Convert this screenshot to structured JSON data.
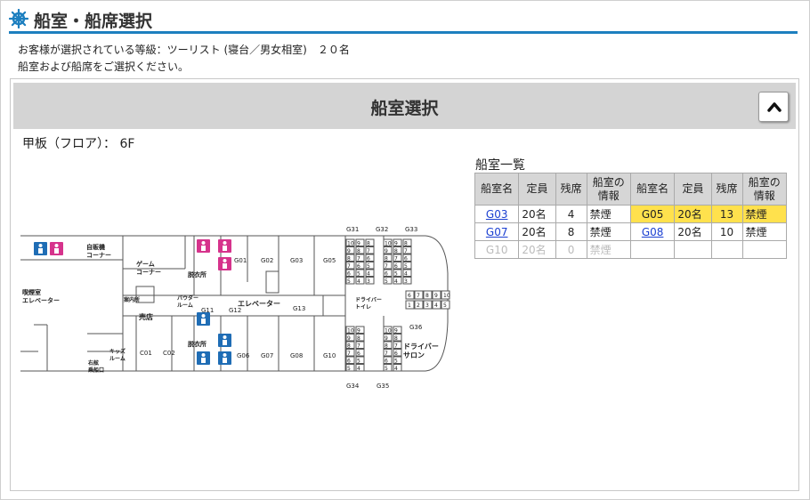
{
  "header": {
    "title": "船室・船席選択"
  },
  "info": {
    "line1": "お客様が選択されている等級：ツーリスト (寝台／男女相室)　２０名",
    "line2": "船室および船席をご選択ください。"
  },
  "panel": {
    "title": "船室選択"
  },
  "floor": {
    "label": "甲板（フロア）： 6F"
  },
  "room_list": {
    "title": "船室一覧",
    "headers": [
      "船室名",
      "定員",
      "残席",
      "船室の\n情報",
      "船室名",
      "定員",
      "残席",
      "船室の\n情報"
    ],
    "rows": [
      {
        "left": {
          "name": "G03",
          "cap": "20名",
          "rem": "4",
          "info": "禁煙",
          "state": "link"
        },
        "right": {
          "name": "G05",
          "cap": "20名",
          "rem": "13",
          "info": "禁煙",
          "state": "selected"
        }
      },
      {
        "left": {
          "name": "G07",
          "cap": "20名",
          "rem": "8",
          "info": "禁煙",
          "state": "link"
        },
        "right": {
          "name": "G08",
          "cap": "20名",
          "rem": "10",
          "info": "禁煙",
          "state": "link"
        }
      },
      {
        "left": {
          "name": "G10",
          "cap": "20名",
          "rem": "0",
          "info": "禁煙",
          "state": "disabled"
        },
        "right": {
          "name": "",
          "cap": "",
          "rem": "",
          "info": "",
          "state": "empty"
        }
      }
    ]
  },
  "deck_plan": {
    "labels": {
      "vending": "自販機\nコーナー",
      "game": "ゲーム\nコーナー",
      "dressing": "脱衣所",
      "smoking_elev": "喫煙室\nエレベーター",
      "info_desk": "案内所",
      "powder": "パウダー\nルーム",
      "elevator": "エレベーター",
      "shop": "売店",
      "driver_toilet": "ドライバー\nトイレ",
      "driver_salon": "ドライバー\nサロン",
      "kids": "キッズ\nルーム",
      "starboard_gate": "右舷\n乗船口"
    },
    "rooms": [
      "G01",
      "G02",
      "G03",
      "G05",
      "G11",
      "G12",
      "G13",
      "G06",
      "G07",
      "G08",
      "G10",
      "C01",
      "C02",
      "G31",
      "G32",
      "G33",
      "G34",
      "G35",
      "G36"
    ],
    "seat_numbers": [
      "10",
      "9",
      "8",
      "7",
      "6",
      "5",
      "4",
      "3",
      "2",
      "1"
    ],
    "seat_row_mid": [
      "6",
      "7",
      "8",
      "9",
      "10"
    ],
    "seat_row_mid2": [
      "1",
      "2",
      "3",
      "4",
      "5"
    ]
  },
  "colors": {
    "accent": "#1d7fbf",
    "selected": "#ffe14d",
    "link": "#1a3fd1",
    "icon_blue": "#1f6db5",
    "icon_pink": "#d6338c"
  }
}
